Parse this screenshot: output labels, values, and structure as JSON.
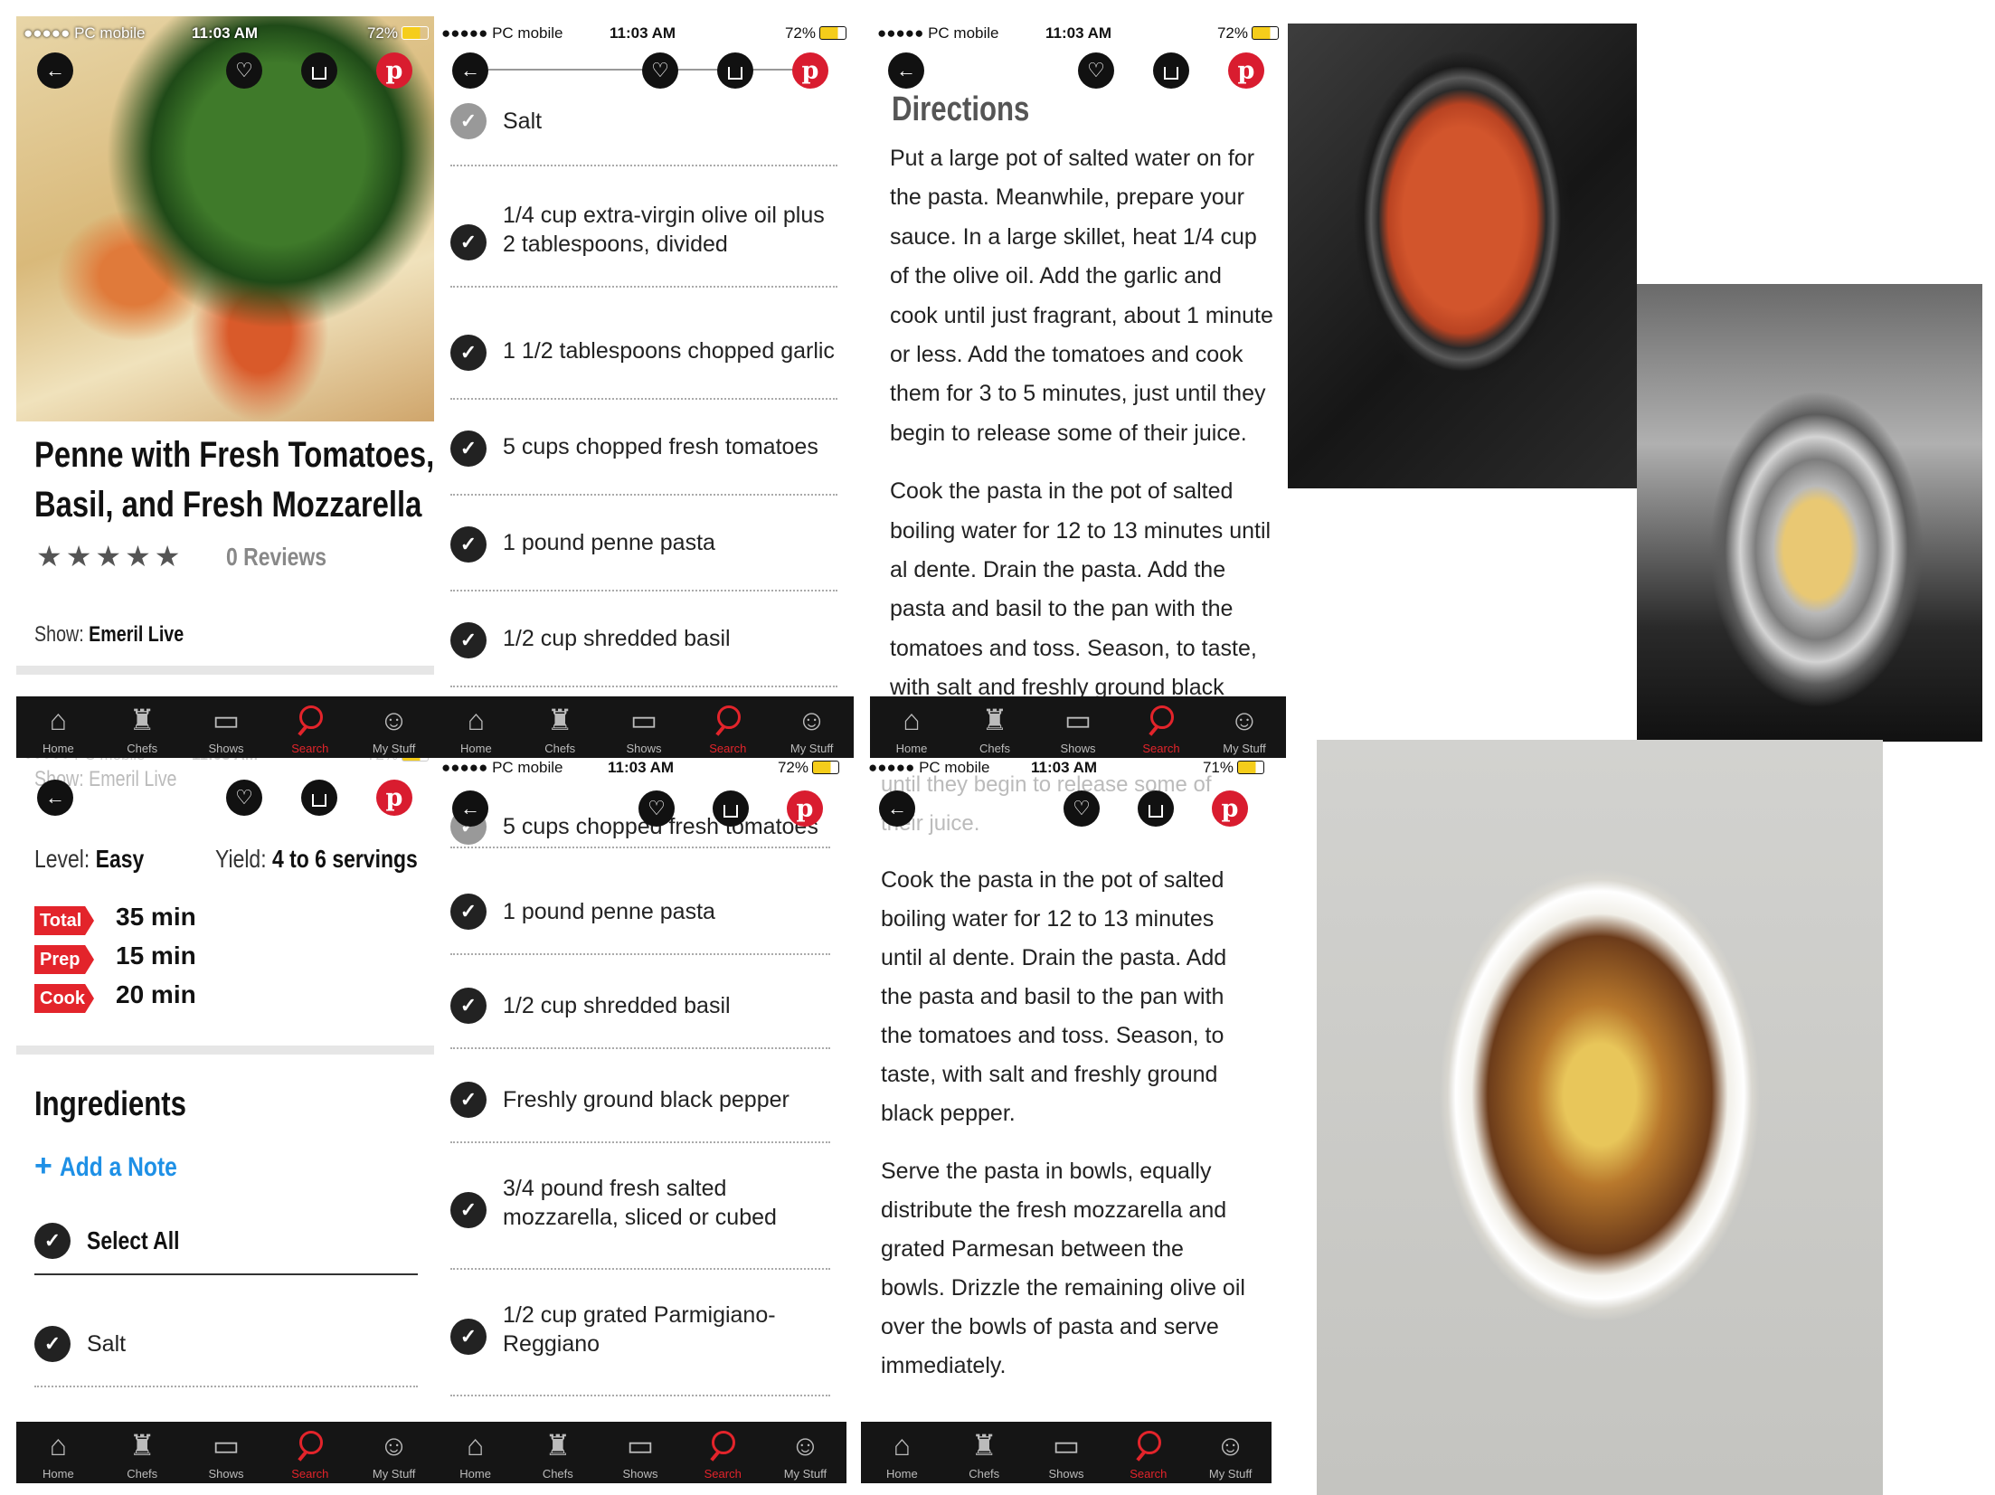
{
  "status": {
    "carrier": "●●●●● PC mobile",
    "time": "11:03 AM",
    "battery": "72%",
    "battery_alt": "71%"
  },
  "tabs": [
    {
      "label": "Home",
      "icon": "home-icon"
    },
    {
      "label": "Chefs",
      "icon": "chef-hat-icon"
    },
    {
      "label": "Shows",
      "icon": "tv-icon"
    },
    {
      "label": "Search",
      "icon": "search-icon"
    },
    {
      "label": "My Stuff",
      "icon": "user-icon"
    }
  ],
  "recipe": {
    "title_line1": "Penne with Fresh Tomatoes,",
    "title_line2": "Basil, and Fresh Mozzarella",
    "stars": "★★★★★",
    "reviews": "0 Reviews",
    "show_label": "Show:",
    "show_value": "Emeril Live"
  },
  "details": {
    "level_label": "Level:",
    "level_value": "Easy",
    "yield_label": "Yield:",
    "yield_value": "4 to 6 servings",
    "total_label": "Total",
    "total_value": "35 min",
    "prep_label": "Prep",
    "prep_value": "15 min",
    "cook_label": "Cook",
    "cook_value": "20 min",
    "ingredients_heading": "Ingredients",
    "add_note": "Add a Note",
    "select_all": "Select All"
  },
  "ingredients": [
    "Salt",
    "1/4 cup extra-virgin olive oil plus 2 tablespoons, divided",
    "1 1/2 tablespoons chopped garlic",
    "5 cups chopped fresh tomatoes",
    "1 pound penne pasta",
    "1/2 cup shredded basil",
    "Freshly ground black pepper",
    "3/4 pound fresh salted mozzarella, sliced or cubed",
    "1/2 cup grated Parmigiano-Reggiano"
  ],
  "directions": {
    "heading": "Directions",
    "step1": "Put a large pot of salted water on for the pasta. Meanwhile, prepare your sauce. In a large skillet, heat 1/4 cup of the olive oil. Add the garlic and cook until just fragrant, about 1 minute or less. Add the tomatoes and cook them for 3 to 5 minutes, just until they begin to release some of their juice.",
    "step2": "Cook the pasta in the pot of salted boiling water for 12 to 13 minutes until al dente. Drain the pasta. Add the pasta and basil to the pan with the tomatoes and toss. Season, to taste, with salt and freshly ground black pepper.",
    "step3": "Serve the pasta in bowls, equally distribute the fresh mozzarella and grated Parmesan between the bowls. Drizzle the remaining olive oil over the bowls of pasta and serve immediately.",
    "fade_top": "until they begin to release some of",
    "fade_juice": "their juice."
  },
  "faded": {
    "select_all": "Select All",
    "emeril": "Show: Emeril Live",
    "tomatoes": "5 cups chopped fresh tomatoes"
  },
  "icons": {
    "back": "back-arrow-icon",
    "favorite": "heart-icon",
    "share": "share-icon",
    "pinterest": "pinterest-icon",
    "check": "checkmark-icon",
    "plus": "plus-icon"
  },
  "colors": {
    "accent": "#e3242b",
    "tabbar": "#151515",
    "pinterest": "#d91c2f"
  }
}
